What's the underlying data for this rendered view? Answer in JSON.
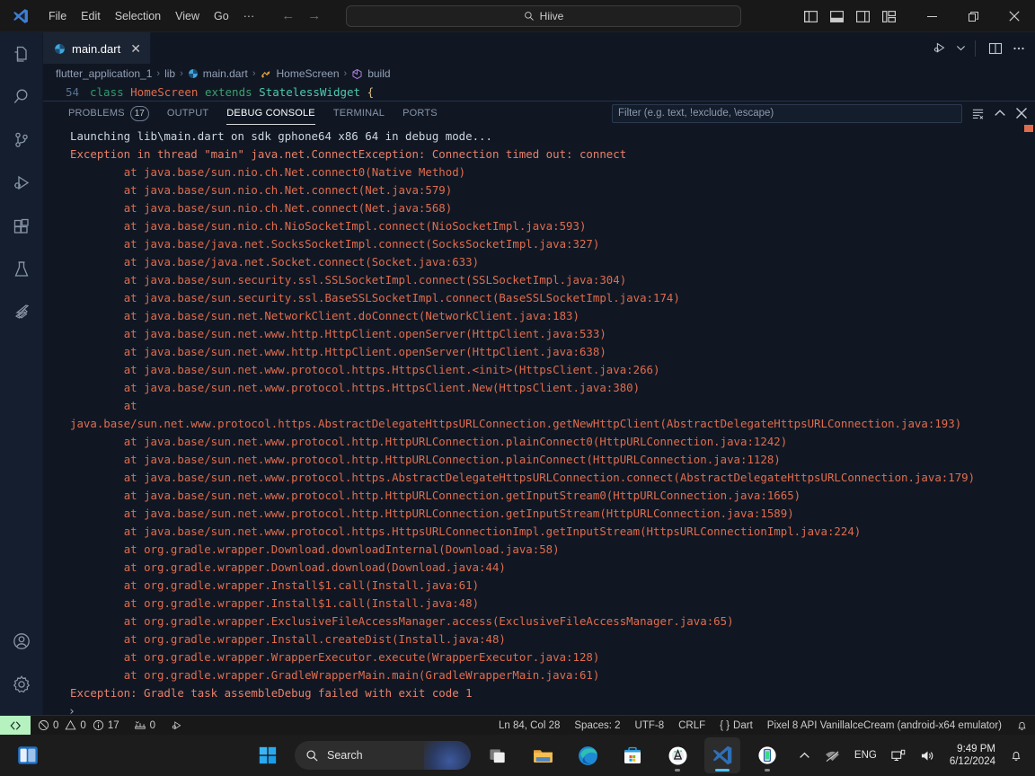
{
  "titlebar": {
    "logo_icon": "vscode-logo-icon",
    "menus": [
      "File",
      "Edit",
      "Selection",
      "View",
      "Go",
      "···"
    ],
    "back_icon": "arrow-left-icon",
    "forward_icon": "arrow-right-icon",
    "search": {
      "icon": "search-icon",
      "value": "Hiive",
      "placeholder": "Search"
    },
    "layout_icons": [
      "toggle-primary-sidebar-icon",
      "toggle-panel-icon",
      "toggle-secondary-sidebar-icon",
      "customize-layout-icon"
    ],
    "window_controls": {
      "minimize": "─",
      "maximize": "restore-icon",
      "close": "✕"
    }
  },
  "activitybar": {
    "items": [
      {
        "name": "explorer",
        "icon": "files-icon"
      },
      {
        "name": "search",
        "icon": "search-icon"
      },
      {
        "name": "source-control",
        "icon": "source-control-icon"
      },
      {
        "name": "run-and-debug",
        "icon": "run-debug-icon"
      },
      {
        "name": "extensions",
        "icon": "extensions-icon"
      },
      {
        "name": "testing",
        "icon": "beaker-icon"
      },
      {
        "name": "flutter",
        "icon": "flutter-icon"
      }
    ],
    "bottom": [
      {
        "name": "accounts",
        "icon": "account-icon"
      },
      {
        "name": "manage",
        "icon": "gear-icon"
      }
    ]
  },
  "editor": {
    "tab": {
      "label": "main.dart",
      "icon": "dart-file-icon",
      "close": "✕"
    },
    "actions": [
      "run-and-debug-icon",
      "chevron-down-icon",
      "split-editor-icon",
      "more-actions-icon"
    ],
    "breadcrumbs": [
      {
        "label": "flutter_application_1",
        "icon": ""
      },
      {
        "label": "lib",
        "icon": ""
      },
      {
        "label": "main.dart",
        "icon": "dart-file-icon"
      },
      {
        "label": "HomeScreen",
        "icon": "class-symbol-icon"
      },
      {
        "label": "build",
        "icon": "method-symbol-icon"
      }
    ],
    "separator": "›",
    "code": {
      "line_number": "54",
      "tokens": [
        {
          "t": "class ",
          "c": "kw"
        },
        {
          "t": "HomeScreen ",
          "c": "typ"
        },
        {
          "t": "extends ",
          "c": "kw2"
        },
        {
          "t": "StatelessWidget ",
          "c": "cls"
        },
        {
          "t": "{",
          "c": "brace"
        }
      ],
      "text": "class HomeScreen extends StatelessWidget {"
    }
  },
  "panel": {
    "tabs": [
      {
        "label": "PROBLEMS",
        "badge": "17",
        "active": false
      },
      {
        "label": "OUTPUT",
        "badge": "",
        "active": false
      },
      {
        "label": "DEBUG CONSOLE",
        "badge": "",
        "active": true
      },
      {
        "label": "TERMINAL",
        "badge": "",
        "active": false
      },
      {
        "label": "PORTS",
        "badge": "",
        "active": false
      }
    ],
    "filter": {
      "placeholder": "Filter (e.g. text, !exclude, \\escape)",
      "value": ""
    },
    "actions": [
      {
        "name": "clear-console-icon"
      },
      {
        "name": "chevron-up-icon"
      },
      {
        "name": "close-panel-icon"
      }
    ],
    "prompt": "›",
    "console_lines": [
      {
        "type": "info",
        "text": "Launching lib\\main.dart on sdk gphone64 x86 64 in debug mode..."
      },
      {
        "type": "err",
        "text": "Exception in thread \"main\" java.net.ConnectException: Connection timed out: connect"
      },
      {
        "type": "at",
        "text": "        at java.base/sun.nio.ch.Net.connect0(Native Method)"
      },
      {
        "type": "at",
        "text": "        at java.base/sun.nio.ch.Net.connect(Net.java:579)"
      },
      {
        "type": "at",
        "text": "        at java.base/sun.nio.ch.Net.connect(Net.java:568)"
      },
      {
        "type": "at",
        "text": "        at java.base/sun.nio.ch.NioSocketImpl.connect(NioSocketImpl.java:593)"
      },
      {
        "type": "at",
        "text": "        at java.base/java.net.SocksSocketImpl.connect(SocksSocketImpl.java:327)"
      },
      {
        "type": "at",
        "text": "        at java.base/java.net.Socket.connect(Socket.java:633)"
      },
      {
        "type": "at",
        "text": "        at java.base/sun.security.ssl.SSLSocketImpl.connect(SSLSocketImpl.java:304)"
      },
      {
        "type": "at",
        "text": "        at java.base/sun.security.ssl.BaseSSLSocketImpl.connect(BaseSSLSocketImpl.java:174)"
      },
      {
        "type": "at",
        "text": "        at java.base/sun.net.NetworkClient.doConnect(NetworkClient.java:183)"
      },
      {
        "type": "at",
        "text": "        at java.base/sun.net.www.http.HttpClient.openServer(HttpClient.java:533)"
      },
      {
        "type": "at",
        "text": "        at java.base/sun.net.www.http.HttpClient.openServer(HttpClient.java:638)"
      },
      {
        "type": "at",
        "text": "        at java.base/sun.net.www.protocol.https.HttpsClient.<init>(HttpsClient.java:266)"
      },
      {
        "type": "at",
        "text": "        at java.base/sun.net.www.protocol.https.HttpsClient.New(HttpsClient.java:380)"
      },
      {
        "type": "at",
        "text": "        at java.base/sun.net.www.protocol.https.AbstractDelegateHttpsURLConnection.getNewHttpClient(AbstractDelegateHttpsURLConnection.java:193)"
      },
      {
        "type": "at",
        "text": "        at java.base/sun.net.www.protocol.http.HttpURLConnection.plainConnect0(HttpURLConnection.java:1242)"
      },
      {
        "type": "at",
        "text": "        at java.base/sun.net.www.protocol.http.HttpURLConnection.plainConnect(HttpURLConnection.java:1128)"
      },
      {
        "type": "at",
        "text": "        at java.base/sun.net.www.protocol.https.AbstractDelegateHttpsURLConnection.connect(AbstractDelegateHttpsURLConnection.java:179)"
      },
      {
        "type": "at",
        "text": "        at java.base/sun.net.www.protocol.http.HttpURLConnection.getInputStream0(HttpURLConnection.java:1665)"
      },
      {
        "type": "at",
        "text": "        at java.base/sun.net.www.protocol.http.HttpURLConnection.getInputStream(HttpURLConnection.java:1589)"
      },
      {
        "type": "at",
        "text": "        at java.base/sun.net.www.protocol.https.HttpsURLConnectionImpl.getInputStream(HttpsURLConnectionImpl.java:224)"
      },
      {
        "type": "at",
        "text": "        at org.gradle.wrapper.Download.downloadInternal(Download.java:58)"
      },
      {
        "type": "at",
        "text": "        at org.gradle.wrapper.Download.download(Download.java:44)"
      },
      {
        "type": "at",
        "text": "        at org.gradle.wrapper.Install$1.call(Install.java:61)"
      },
      {
        "type": "at",
        "text": "        at org.gradle.wrapper.Install$1.call(Install.java:48)"
      },
      {
        "type": "at",
        "text": "        at org.gradle.wrapper.ExclusiveFileAccessManager.access(ExclusiveFileAccessManager.java:65)"
      },
      {
        "type": "at",
        "text": "        at org.gradle.wrapper.Install.createDist(Install.java:48)"
      },
      {
        "type": "at",
        "text": "        at org.gradle.wrapper.WrapperExecutor.execute(WrapperExecutor.java:128)"
      },
      {
        "type": "at",
        "text": "        at org.gradle.wrapper.GradleWrapperMain.main(GradleWrapperMain.java:61)"
      },
      {
        "type": "err",
        "text": "Exception: Gradle task assembleDebug failed with exit code 1"
      }
    ]
  },
  "statusbar": {
    "remote_icon": "remote-window-icon",
    "errors": "0",
    "warnings": "0",
    "infos": "17",
    "ports": "0",
    "run_icon": "run-debug-icon",
    "cursor_position": "Ln 84, Col 28",
    "indentation": "Spaces: 2",
    "encoding": "UTF-8",
    "eol": "CRLF",
    "language": "Dart",
    "language_icon": "{ }",
    "device": "Pixel 8 API VanillalceCream (android-x64 emulator)",
    "bell_icon": "bell-icon"
  },
  "taskbar": {
    "widgets_icon": "widgets-icon",
    "start_icon": "windows-start-icon",
    "search": {
      "icon": "search-icon",
      "placeholder": "Search"
    },
    "apps": [
      {
        "name": "task-view",
        "icon": "task-view-icon",
        "active": false,
        "running": false
      },
      {
        "name": "file-explorer",
        "icon": "folder-icon",
        "active": false,
        "running": false
      },
      {
        "name": "microsoft-edge",
        "icon": "edge-icon",
        "active": false,
        "running": false
      },
      {
        "name": "microsoft-store",
        "icon": "store-icon",
        "active": false,
        "running": false
      },
      {
        "name": "android-studio",
        "icon": "android-studio-icon",
        "active": false,
        "running": true
      },
      {
        "name": "visual-studio-code",
        "icon": "vscode-icon",
        "active": true,
        "running": true
      },
      {
        "name": "android-emulator",
        "icon": "emulator-icon",
        "active": false,
        "running": true
      }
    ],
    "tray": {
      "chevron_icon": "chevron-up-icon",
      "network_icon": "network-disconnected-icon",
      "language": "ENG",
      "remote_icon": "remote-desktop-icon",
      "volume_icon": "volume-icon",
      "time": "9:49 PM",
      "date": "6/12/2024",
      "notification_icon": "bell-icon"
    }
  },
  "colors": {
    "accent": "#0078d4",
    "error": "#e06c4e",
    "panel_bg": "#101723",
    "titlebar_bg": "#181818",
    "activitybar_bg": "#141e2e",
    "remote_green": "#b5f2c0"
  }
}
